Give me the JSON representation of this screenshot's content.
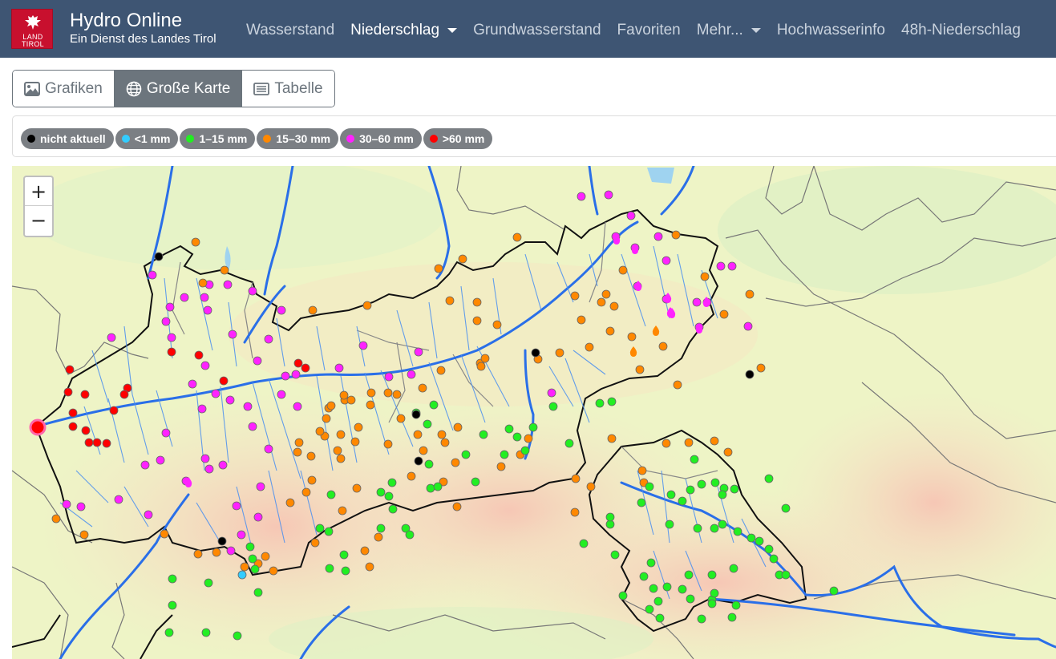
{
  "brand": {
    "title": "Hydro Online",
    "subtitle": "Ein Dienst des Landes Tirol",
    "logo_text": [
      "LAND",
      "TIROL"
    ],
    "logo_color": "#c8102e"
  },
  "nav": [
    {
      "label": "Wasserstand",
      "active": false,
      "dropdown": false
    },
    {
      "label": "Niederschlag",
      "active": true,
      "dropdown": true
    },
    {
      "label": "Grundwasserstand",
      "active": false,
      "dropdown": false
    },
    {
      "label": "Favoriten",
      "active": false,
      "dropdown": false
    },
    {
      "label": "Mehr...",
      "active": false,
      "dropdown": true
    },
    {
      "label": "Hochwasserinfo",
      "active": false,
      "dropdown": false
    },
    {
      "label": "48h-Niederschlag",
      "active": false,
      "dropdown": false
    }
  ],
  "view_buttons": [
    {
      "label": "Grafiken",
      "icon": "image-icon",
      "active": false
    },
    {
      "label": "Große Karte",
      "icon": "globe-icon",
      "active": true
    },
    {
      "label": "Tabelle",
      "icon": "list-icon",
      "active": false
    }
  ],
  "legend": [
    {
      "label": "nicht aktuell",
      "color": "#000000"
    },
    {
      "label": "<1 mm",
      "color": "#33ccff"
    },
    {
      "label": "1–15 mm",
      "color": "#22ee22"
    },
    {
      "label": "15–30 mm",
      "color": "#ff8800"
    },
    {
      "label": "30–60 mm",
      "color": "#ff22ff"
    },
    {
      "label": ">60 mm",
      "color": "#ff0000"
    }
  ],
  "zoom": {
    "in": "+",
    "out": "−"
  }
}
